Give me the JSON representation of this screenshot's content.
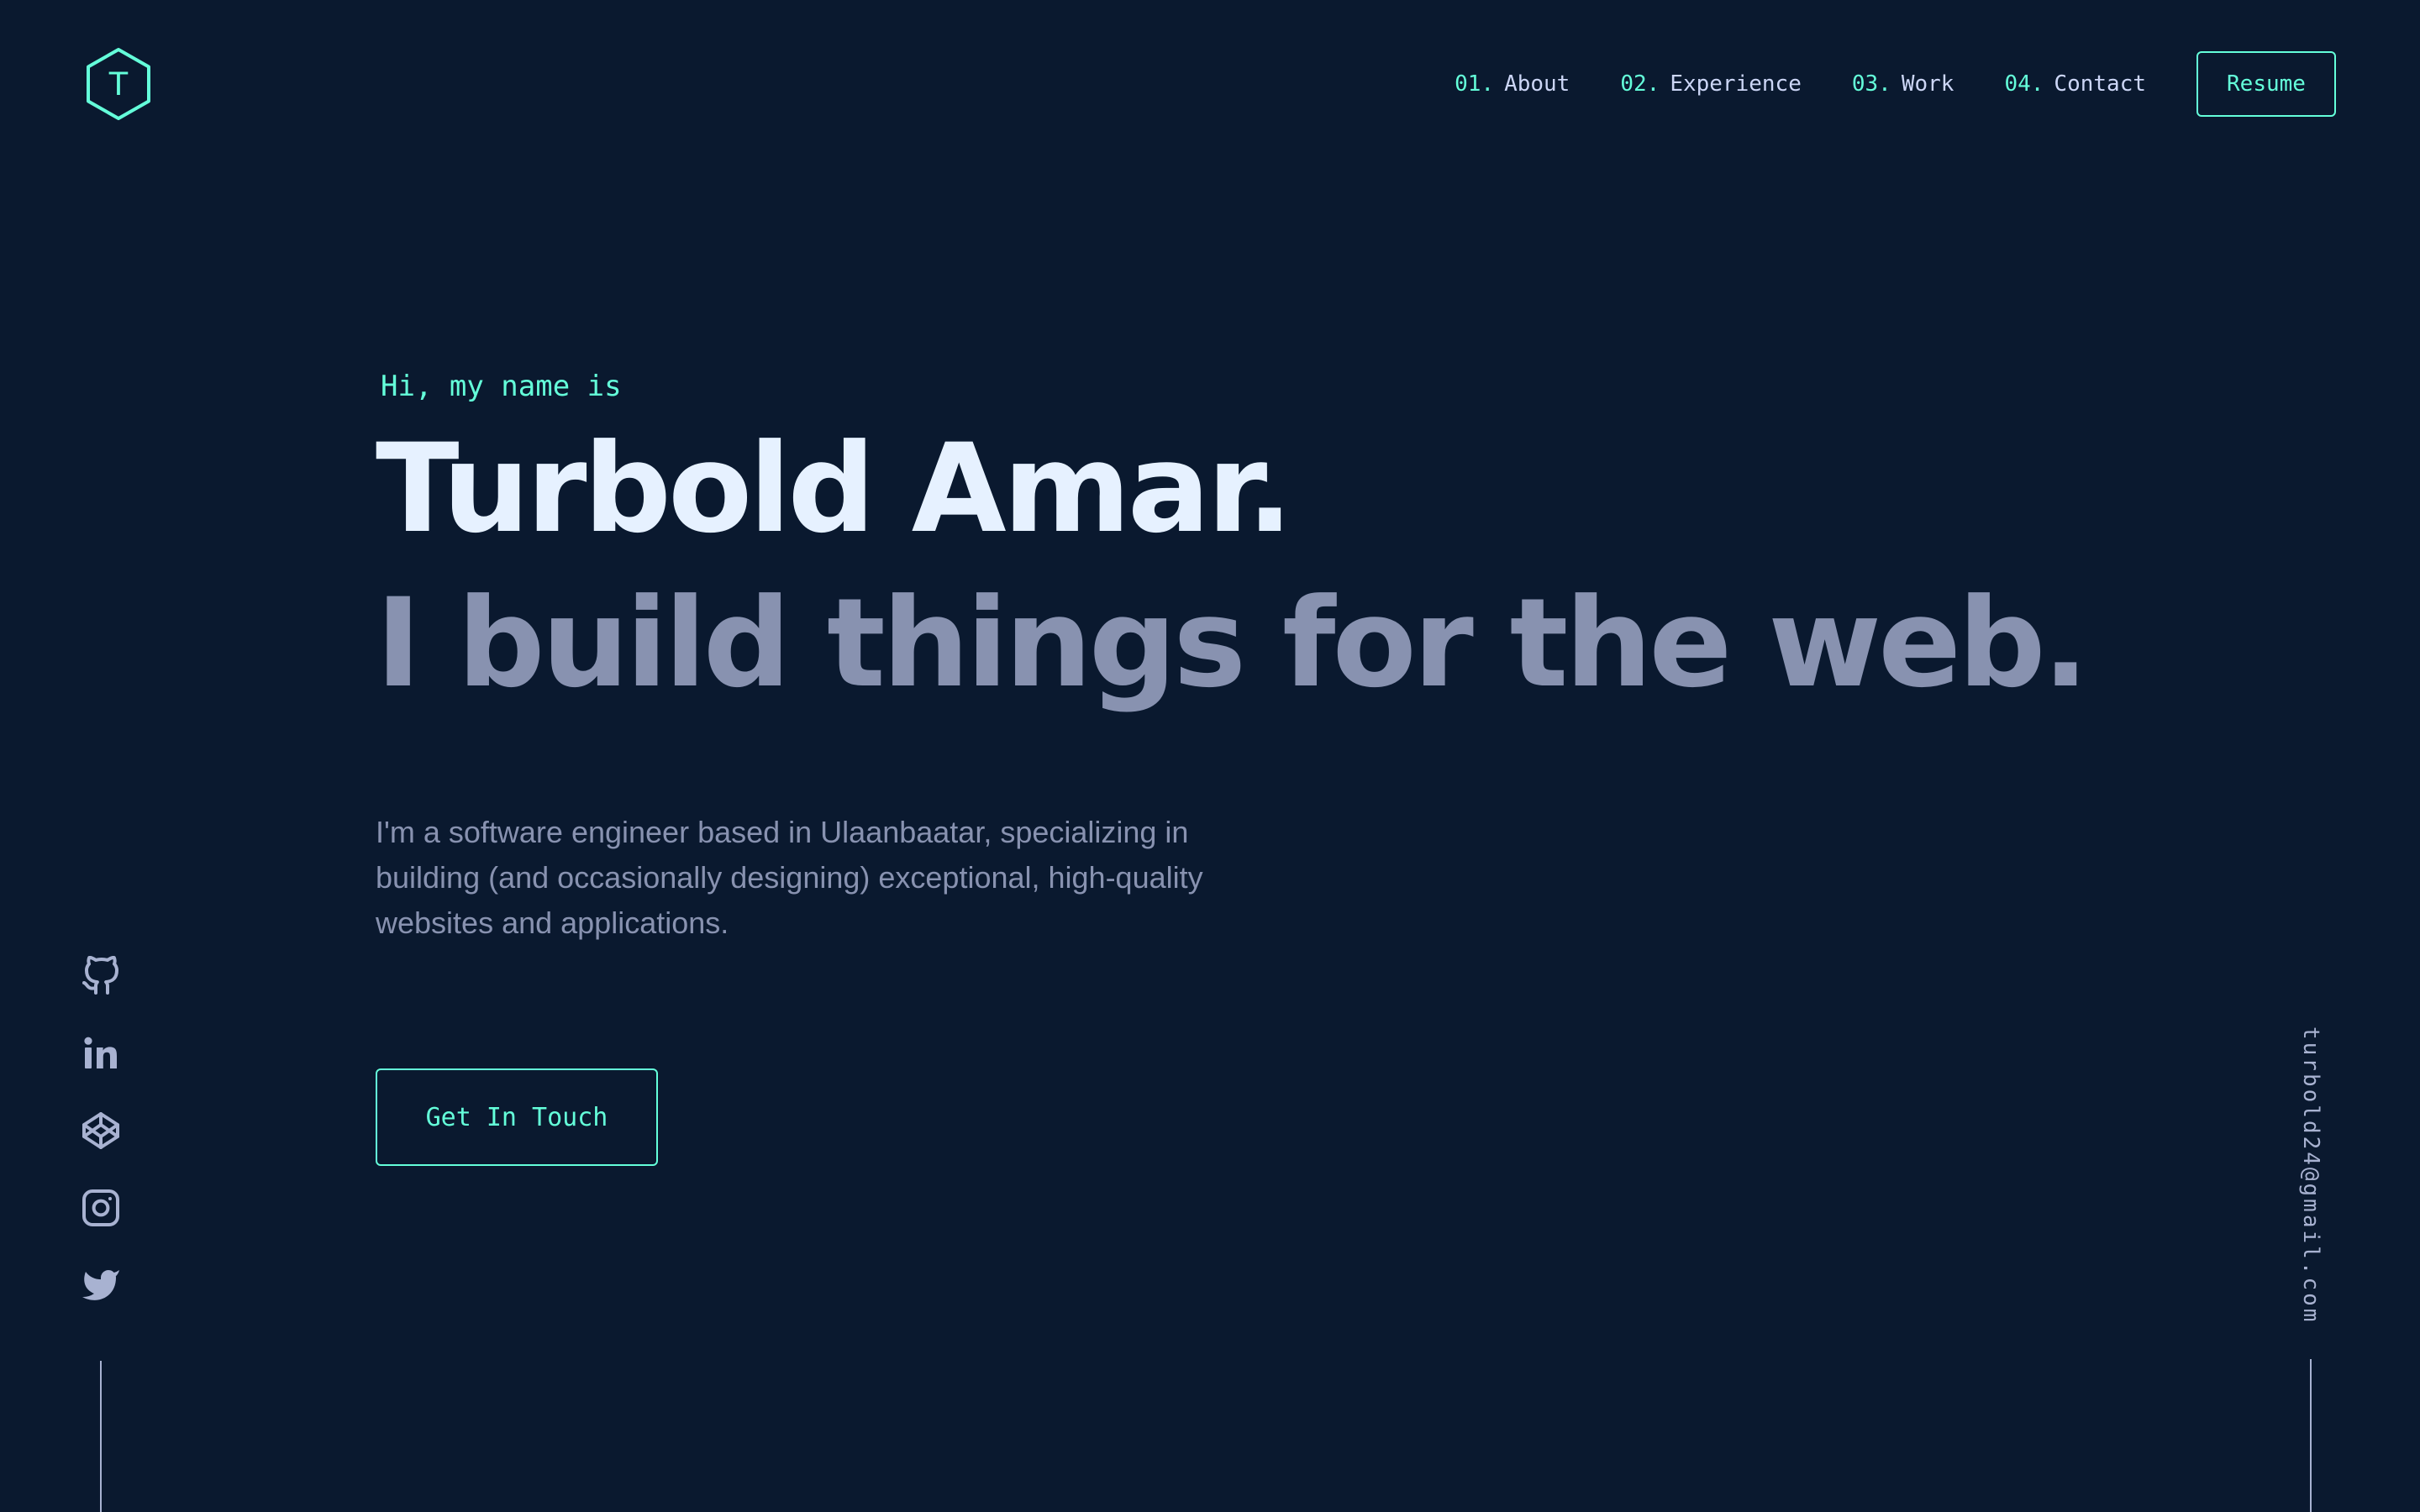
{
  "header": {
    "logo_letter": "T",
    "nav": [
      {
        "number": "01.",
        "label": "About"
      },
      {
        "number": "02.",
        "label": "Experience"
      },
      {
        "number": "03.",
        "label": "Work"
      },
      {
        "number": "04.",
        "label": "Contact"
      }
    ],
    "resume_label": "Resume"
  },
  "hero": {
    "greeting": "Hi, my name is",
    "name": "Turbold Amar.",
    "tagline": "I build things for the web.",
    "bio": "I'm a software engineer based in Ulaanbaatar, specializing in building (and occasionally designing) exceptional, high-quality websites and applications.",
    "cta_label": "Get In Touch"
  },
  "social": {
    "icons": [
      "github-icon",
      "linkedin-icon",
      "codepen-icon",
      "instagram-icon",
      "twitter-icon"
    ]
  },
  "email": "turbold24@gmail.com",
  "colors": {
    "background": "#0a192f",
    "accent": "#64ffda",
    "heading": "#e6f1ff",
    "text": "#ccd6f6",
    "muted": "#8892b0",
    "rail": "#a8b2d1"
  }
}
